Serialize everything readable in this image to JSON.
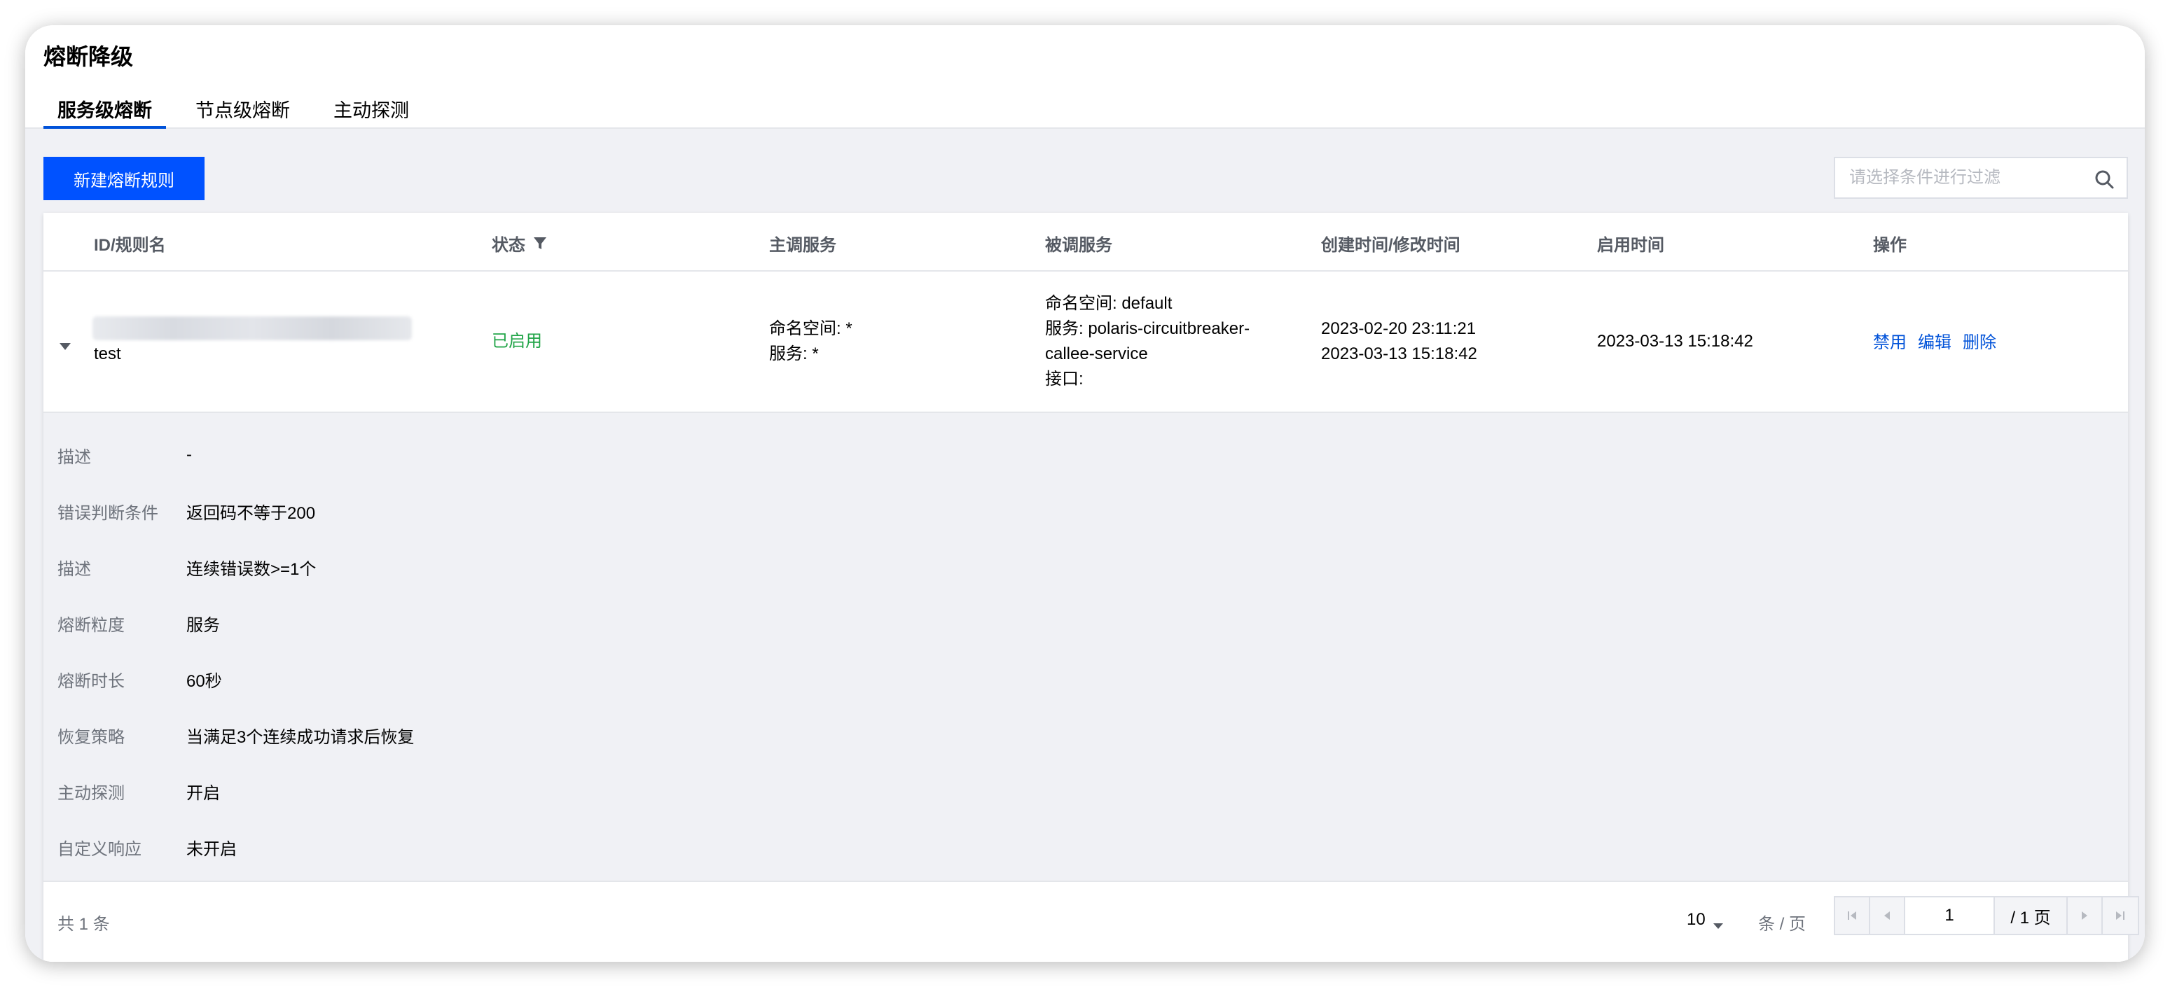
{
  "page": {
    "title": "熔断降级"
  },
  "tabs": [
    {
      "label": "服务级熔断",
      "active": true
    },
    {
      "label": "节点级熔断",
      "active": false
    },
    {
      "label": "主动探测",
      "active": false
    }
  ],
  "toolbar": {
    "new_rule_label": "新建熔断规则",
    "search_placeholder": "请选择条件进行过滤",
    "search_icon": "search-icon"
  },
  "table": {
    "columns": {
      "id_name": "ID/规则名",
      "status": "状态",
      "caller": "主调服务",
      "callee": "被调服务",
      "times": "创建时间/修改时间",
      "enable_time": "启用时间",
      "actions": "操作"
    },
    "row": {
      "name": "test",
      "status": "已启用",
      "caller_namespace": "命名空间: *",
      "caller_service": "服务: *",
      "callee_namespace": "命名空间: default",
      "callee_service_1": "服务: polaris-circuitbreaker-",
      "callee_service_2": "callee-service",
      "callee_interface": "接口:",
      "created": "2023-02-20 23:11:21",
      "modified": "2023-03-13 15:18:42",
      "enabled_at": "2023-03-13 15:18:42",
      "actions": {
        "disable": "禁用",
        "edit": "编辑",
        "delete": "删除"
      }
    },
    "details": [
      {
        "label": "描述",
        "value": "-"
      },
      {
        "label": "错误判断条件",
        "value": "返回码不等于200"
      },
      {
        "label": "描述",
        "value": "连续错误数>=1个"
      },
      {
        "label": "熔断粒度",
        "value": "服务"
      },
      {
        "label": "熔断时长",
        "value": "60秒"
      },
      {
        "label": "恢复策略",
        "value": "当满足3个连续成功请求后恢复"
      },
      {
        "label": "主动探测",
        "value": "开启"
      },
      {
        "label": "自定义响应",
        "value": "未开启"
      }
    ]
  },
  "pagination": {
    "total_text": "共 1 条",
    "page_size": "10",
    "per_page_unit": "条 / 页",
    "current_page": "1",
    "total_pages_text": "/ 1 页"
  },
  "colors": {
    "primary": "#0052ff",
    "link": "#0052d9",
    "status_enabled": "#20a447",
    "background": "#f0f1f5"
  }
}
